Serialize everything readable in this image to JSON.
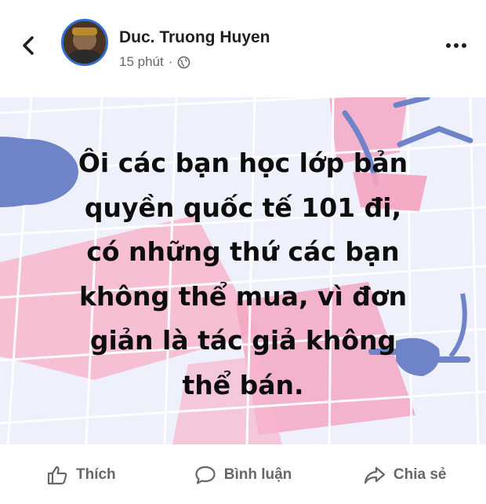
{
  "header": {
    "author_name": "Duc. Truong Huyen",
    "timestamp": "15 phút",
    "separator": "·",
    "privacy_icon": "globe-icon",
    "back_icon": "chevron-left-icon",
    "more_icon": "more-horizontal-icon"
  },
  "post": {
    "text": "Ôi các bạn học lớp bản\nquyền quốc tế 101 đi,\ncó những thứ các bạn\nkhông thể mua, vì đơn\ngiản là tác giả không\nthể bán.",
    "background_colors": {
      "base": "#eef0fb",
      "grid": "#ffffff",
      "pink": "#f7b6cc",
      "blue": "#6f83c9"
    }
  },
  "actions": [
    {
      "label": "Thích",
      "icon": "thumbs-up-icon"
    },
    {
      "label": "Bình luận",
      "icon": "comment-icon"
    },
    {
      "label": "Chia sẻ",
      "icon": "share-icon"
    }
  ],
  "colors": {
    "text_primary": "#1c1e21",
    "text_secondary": "#65676b",
    "avatar_ring": "#2f6fd6"
  }
}
